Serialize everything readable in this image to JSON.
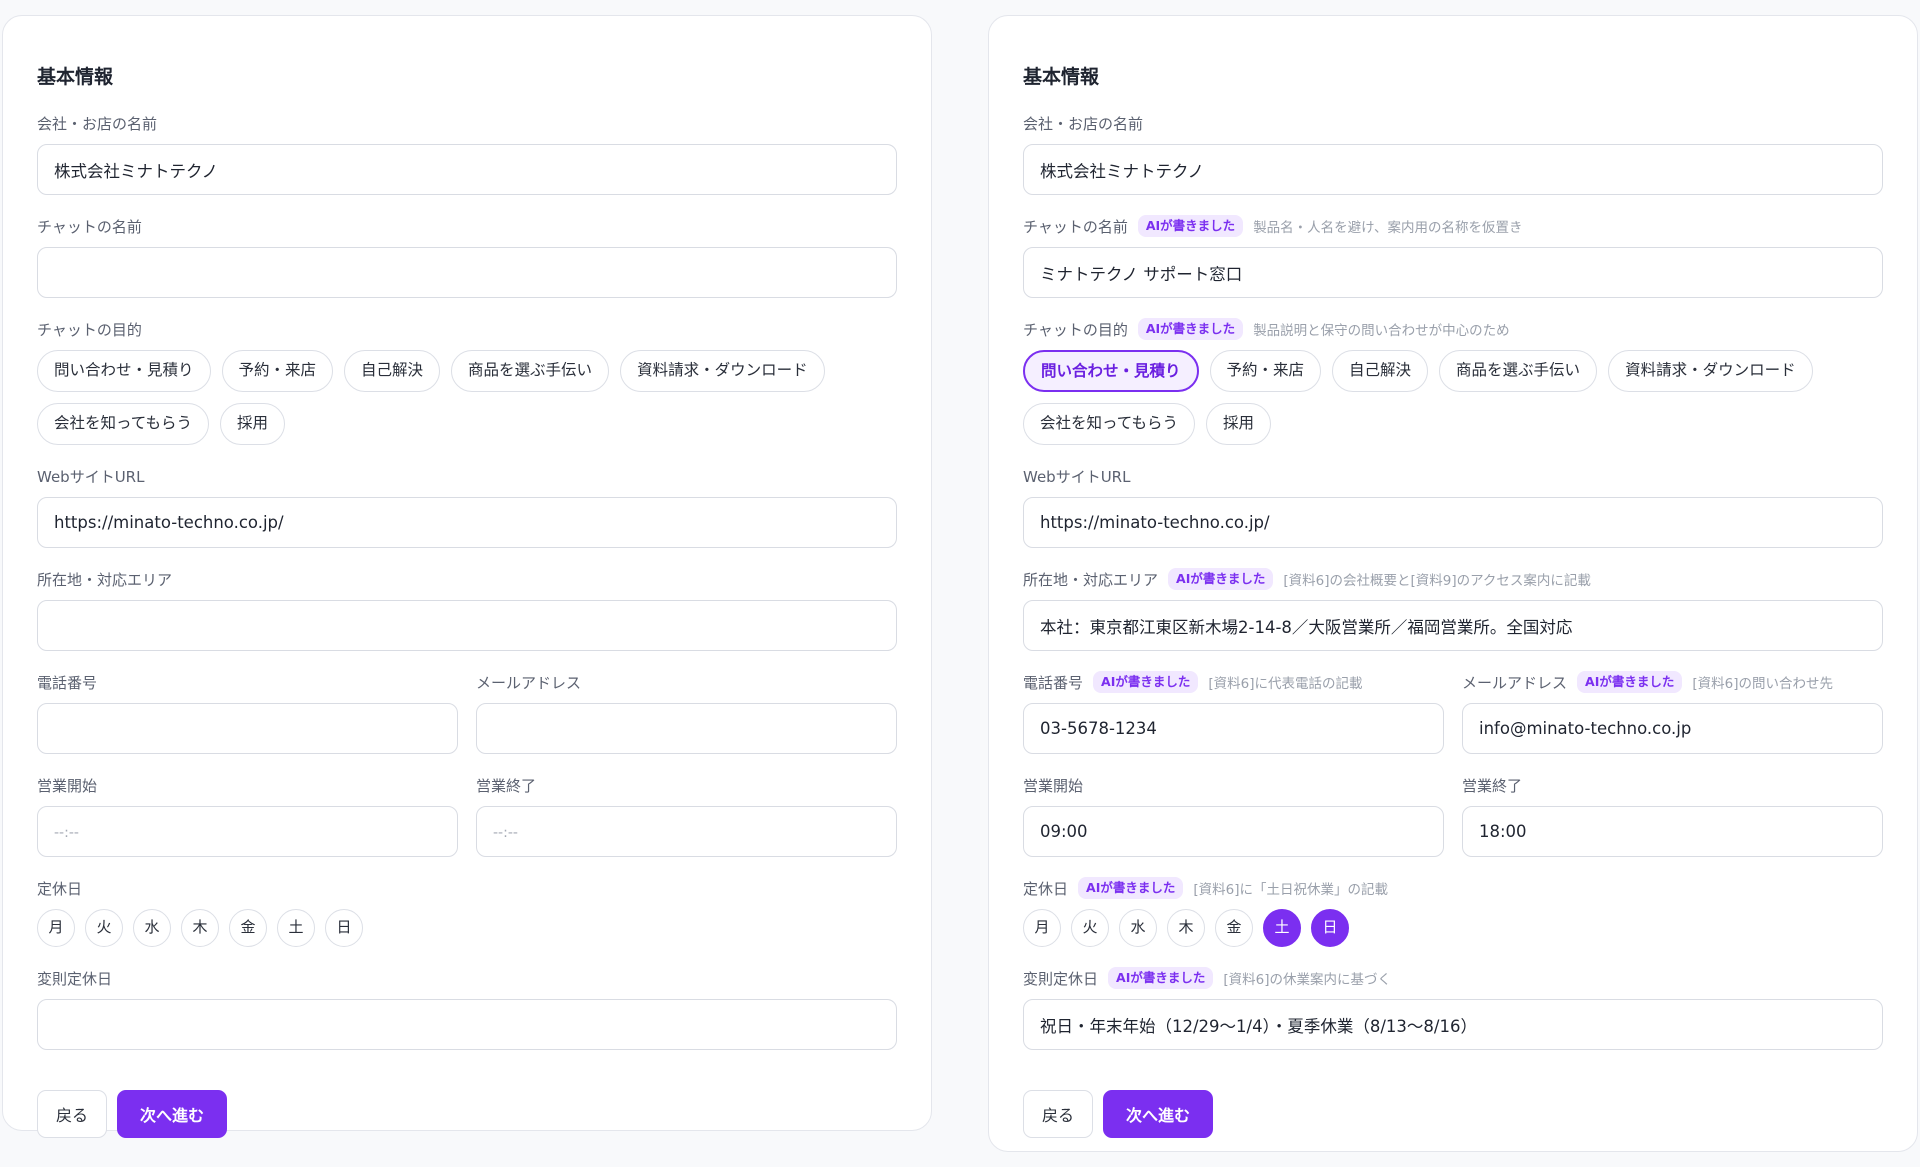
{
  "left": {
    "section_title": "基本情報",
    "company": {
      "label": "会社・お店の名前",
      "value": "株式会社ミナトテクノ"
    },
    "chat_name": {
      "label": "チャットの名前",
      "value": ""
    },
    "purpose": {
      "label": "チャットの目的",
      "options": [
        "問い合わせ・見積り",
        "予約・来店",
        "自己解決",
        "商品を選ぶ手伝い",
        "資料請求・ダウンロード",
        "会社を知ってもらう",
        "採用"
      ],
      "selected": []
    },
    "website": {
      "label": "WebサイトURL",
      "value": "https://minato-techno.co.jp/"
    },
    "location": {
      "label": "所在地・対応エリア",
      "value": ""
    },
    "phone": {
      "label": "電話番号",
      "value": ""
    },
    "email": {
      "label": "メールアドレス",
      "value": ""
    },
    "open_time": {
      "label": "営業開始",
      "value": "",
      "placeholder": "--:--"
    },
    "close_time": {
      "label": "営業終了",
      "value": "",
      "placeholder": "--:--"
    },
    "holidays": {
      "label": "定休日",
      "days": [
        "月",
        "火",
        "水",
        "木",
        "金",
        "土",
        "日"
      ],
      "selected": []
    },
    "irregular_holidays": {
      "label": "変則定休日",
      "value": ""
    },
    "back_label": "戻る",
    "next_label": "次へ進む"
  },
  "right": {
    "section_title": "基本情報",
    "ai_badge": "AIが書きました",
    "company": {
      "label": "会社・お店の名前",
      "value": "株式会社ミナトテクノ"
    },
    "chat_name": {
      "label": "チャットの名前",
      "value": "ミナトテクノ サポート窓口",
      "note": "製品名・人名を避け、案内用の名称を仮置き"
    },
    "purpose": {
      "label": "チャットの目的",
      "note": "製品説明と保守の問い合わせが中心のため",
      "options": [
        "問い合わせ・見積り",
        "予約・来店",
        "自己解決",
        "商品を選ぶ手伝い",
        "資料請求・ダウンロード",
        "会社を知ってもらう",
        "採用"
      ],
      "selected": [
        "問い合わせ・見積り"
      ]
    },
    "website": {
      "label": "WebサイトURL",
      "value": "https://minato-techno.co.jp/"
    },
    "location": {
      "label": "所在地・対応エリア",
      "value": "本社：東京都江東区新木場2-14-8／大阪営業所／福岡営業所。全国対応",
      "note": "[資料6]の会社概要と[資料9]のアクセス案内に記載"
    },
    "phone": {
      "label": "電話番号",
      "value": "03-5678-1234",
      "note": "[資料6]に代表電話の記載"
    },
    "email": {
      "label": "メールアドレス",
      "value": "info@minato-techno.co.jp",
      "note": "[資料6]の問い合わせ先"
    },
    "open_time": {
      "label": "営業開始",
      "value": "09:00"
    },
    "close_time": {
      "label": "営業終了",
      "value": "18:00"
    },
    "holidays": {
      "label": "定休日",
      "note": "[資料6]に「土日祝休業」の記載",
      "days": [
        "月",
        "火",
        "水",
        "木",
        "金",
        "土",
        "日"
      ],
      "selected": [
        "土",
        "日"
      ]
    },
    "irregular_holidays": {
      "label": "変則定休日",
      "value": "祝日・年末年始（12/29〜1/4）・夏季休業（8/13〜8/16）",
      "note": "[資料6]の休業案内に基づく"
    },
    "back_label": "戻る",
    "next_label": "次へ進む"
  },
  "colors": {
    "accent": "#7b2ff0",
    "badge_bg": "#f1e8ff",
    "page_bg": "#f8f9fb"
  }
}
